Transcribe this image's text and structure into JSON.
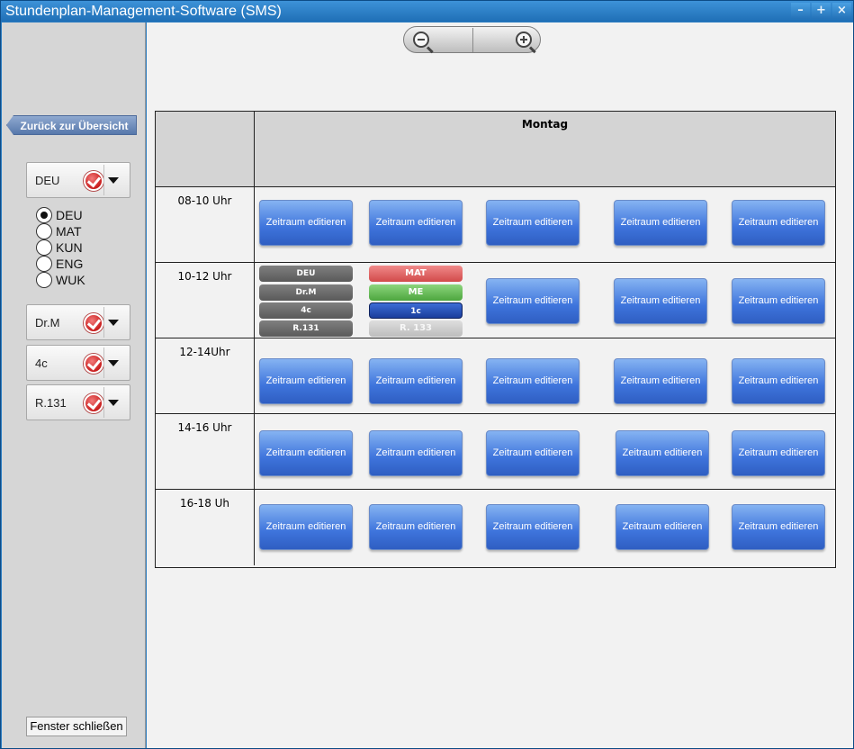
{
  "window": {
    "title": "Stundenplan-Management-Software (SMS)",
    "controls": [
      "–",
      "+",
      "×"
    ]
  },
  "sidebar": {
    "back_label": "Zurück zur Übersicht",
    "dropdowns": [
      {
        "label": "DEU"
      },
      {
        "label": "Dr.M"
      },
      {
        "label": "4c"
      },
      {
        "label": "R.131"
      }
    ],
    "radios": [
      {
        "label": "DEU",
        "selected": true
      },
      {
        "label": "MAT",
        "selected": false
      },
      {
        "label": "KUN",
        "selected": false
      },
      {
        "label": "ENG",
        "selected": false
      },
      {
        "label": "WUK",
        "selected": false
      }
    ],
    "close_label": "Fenster schließen"
  },
  "schedule": {
    "day": "Montag",
    "slot_label": "Zeitraum editieren",
    "times": [
      "08-10 Uhr",
      "10-12 Uhr",
      "12-14Uhr",
      "14-16 Uhr",
      "16-18 Uh"
    ],
    "booked_a": [
      "DEU",
      "Dr.M",
      "4c",
      "R.131"
    ],
    "booked_b": [
      "MAT",
      "ME",
      "1c",
      "R. 133"
    ]
  },
  "colors": {
    "titlebar": "#2b7cc1",
    "slot_button": "#3e74dc",
    "sidebar": "#d6d6d6"
  }
}
